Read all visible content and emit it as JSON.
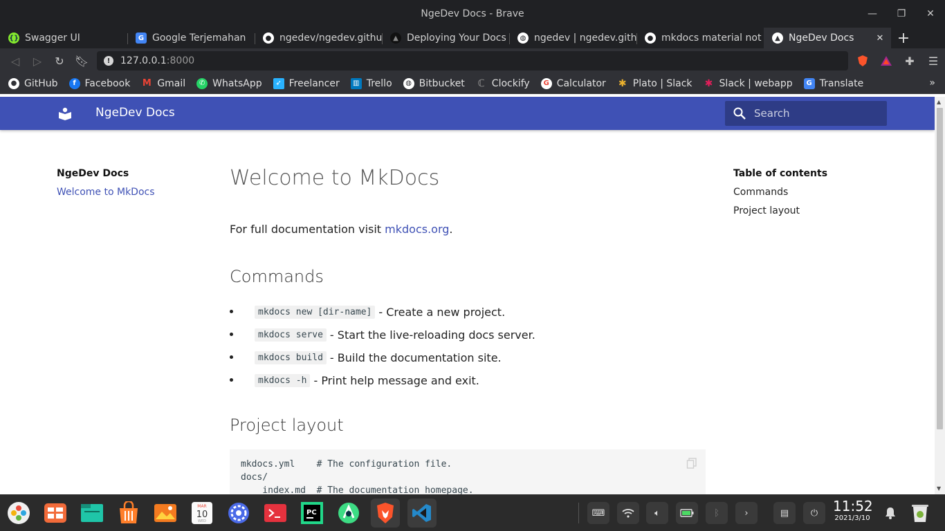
{
  "window": {
    "title": "NgeDev Docs - Brave"
  },
  "tabs": [
    {
      "label": "Swagger UI",
      "icon": "swagger-icon",
      "color": "#85ea2d"
    },
    {
      "label": "Google Terjemahan",
      "icon": "google-translate-icon",
      "color": "#4285f4"
    },
    {
      "label": "ngedev/ngedev.githu",
      "icon": "github-icon",
      "color": "#ffffff"
    },
    {
      "label": "Deploying Your Docs -",
      "icon": "mkdocs-icon",
      "color": "#222222"
    },
    {
      "label": "ngedev | ngedev.gith",
      "icon": "globe-icon",
      "color": "#ffffff"
    },
    {
      "label": "mkdocs material not w",
      "icon": "github-icon",
      "color": "#ffffff"
    },
    {
      "label": "NgeDev Docs",
      "icon": "mkdocs-icon",
      "color": "#ffffff",
      "active": true,
      "close": "✕"
    }
  ],
  "newtab": "+",
  "address": {
    "host": "127.0.0.1",
    "port": ":8000"
  },
  "bookmarks": [
    {
      "label": "GitHub",
      "icon": "github-icon",
      "color": "#ffffff"
    },
    {
      "label": "Facebook",
      "icon": "facebook-icon",
      "color": "#1877f2"
    },
    {
      "label": "Gmail",
      "icon": "gmail-icon",
      "color": "#ea4335"
    },
    {
      "label": "WhatsApp",
      "icon": "whatsapp-icon",
      "color": "#25d366"
    },
    {
      "label": "Freelancer",
      "icon": "freelancer-icon",
      "color": "#29b2fe"
    },
    {
      "label": "Trello",
      "icon": "trello-icon",
      "color": "#0079bf"
    },
    {
      "label": "Bitbucket",
      "icon": "globe-icon",
      "color": "#ffffff"
    },
    {
      "label": "Clockify",
      "icon": "clockify-icon",
      "color": "#03a9f4"
    },
    {
      "label": "Calculator",
      "icon": "google-icon",
      "color": "#ffffff"
    },
    {
      "label": "Plato | Slack",
      "icon": "slack-icon",
      "color": "#e01e5a"
    },
    {
      "label": "Slack | webapp",
      "icon": "slack-icon",
      "color": "#e01e5a"
    },
    {
      "label": "Translate",
      "icon": "google-translate-icon",
      "color": "#4285f4"
    }
  ],
  "site": {
    "title": "NgeDev Docs",
    "search_placeholder": "Search",
    "accent": "#3f51b5"
  },
  "nav": {
    "title": "NgeDev Docs",
    "items": [
      "Welcome to MkDocs"
    ]
  },
  "toc": {
    "title": "Table of contents",
    "items": [
      "Commands",
      "Project layout"
    ]
  },
  "content": {
    "h1": "Welcome to MkDocs",
    "intro_text": "For full documentation visit ",
    "intro_link": "mkdocs.org",
    "intro_end": ".",
    "commands_heading": "Commands",
    "commands": [
      {
        "code": "mkdocs new [dir-name]",
        "desc": "- Create a new project."
      },
      {
        "code": "mkdocs serve",
        "desc": "- Start the live-reloading docs server."
      },
      {
        "code": "mkdocs build",
        "desc": "- Build the documentation site."
      },
      {
        "code": "mkdocs -h",
        "desc": "- Print help message and exit."
      }
    ],
    "layout_heading": "Project layout",
    "code_lines": [
      "mkdocs.yml    # The configuration file.",
      "docs/",
      "    index.md  # The documentation homepage."
    ]
  },
  "taskbar": {
    "time": "11:52",
    "date": "2021/3/10",
    "calendar_month": "MAR",
    "calendar_day": "10",
    "calendar_weekday": "WED"
  }
}
